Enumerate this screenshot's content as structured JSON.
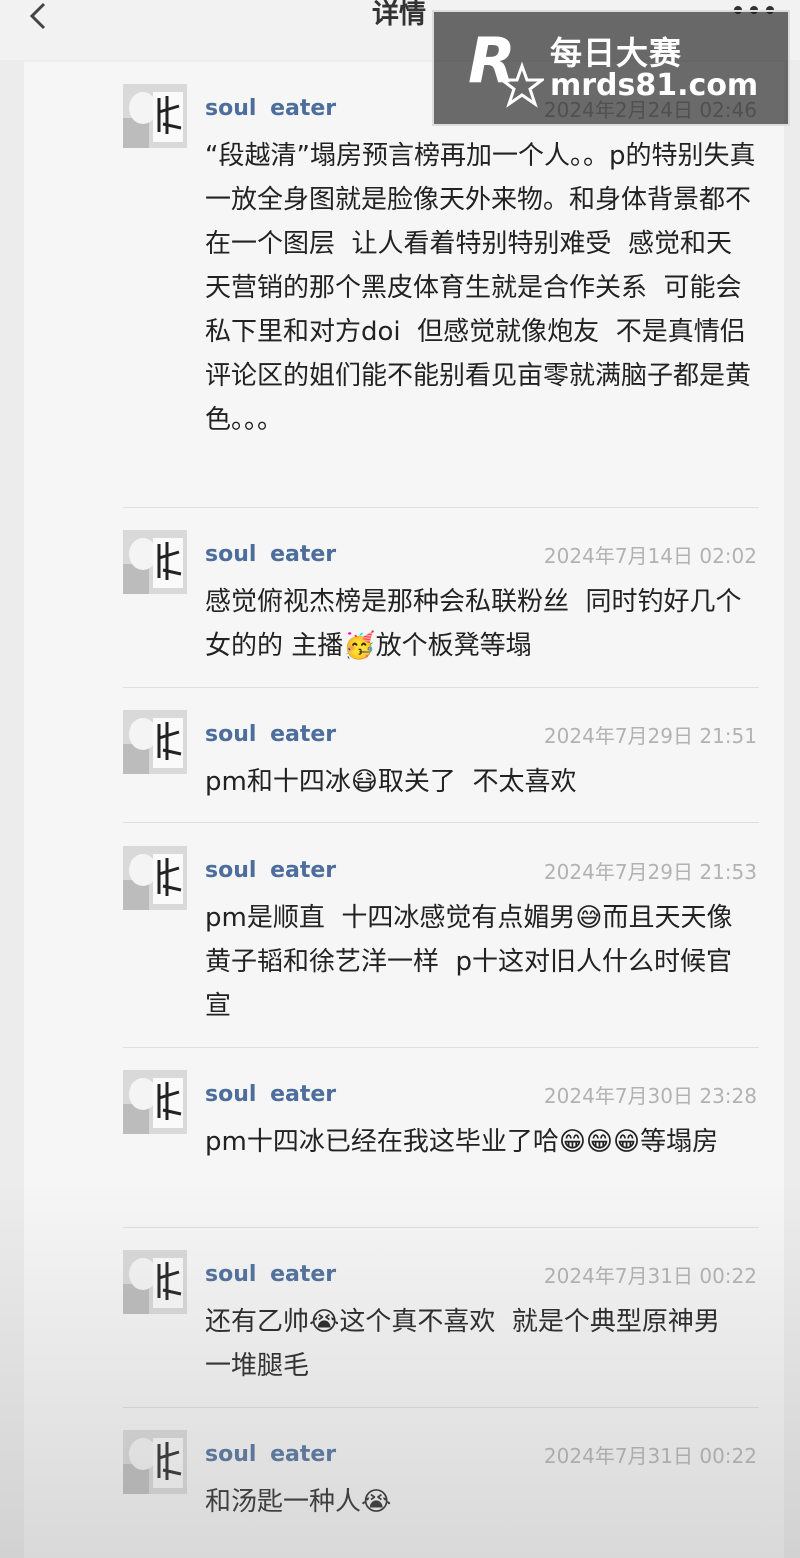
{
  "header": {
    "title": "详情"
  },
  "watermark": {
    "text_cn": "每日大赛",
    "url": "mrds81.com"
  },
  "comments": [
    {
      "user": "soul  eater",
      "time": "2024年2月24日  02:46",
      "text": "“段越清”塌房预言榜再加一个人。。p的特别失真  一放全身图就是脸像天外来物。和身体背景都不在一个图层  让人看着特别特别难受  感觉和天天营销的那个黑皮体育生就是合作关系  可能会私下里和对方doi  但感觉就像炮友  不是真情侣\n评论区的姐们能不能别看见亩零就满脑子都是黄色。。。"
    },
    {
      "user": "soul  eater",
      "time": "2024年7月14日  02:02",
      "text": "感觉俯视杰榜是那种会私联粉丝  同时钓好几个女的的 主播🥳放个板凳等塌"
    },
    {
      "user": "soul  eater",
      "time": "2024年7月29日  21:51",
      "text": "pm和十四冰😷取关了  不太喜欢"
    },
    {
      "user": "soul  eater",
      "time": "2024年7月29日  21:53",
      "text": "pm是顺直  十四冰感觉有点媚男😅而且天天像黄子韬和徐艺洋一样  p十这对旧人什么时候官宣"
    },
    {
      "user": "soul  eater",
      "time": "2024年7月30日  23:28",
      "text": "pm十四冰已经在我这毕业了哈😁😁😁等塌房"
    },
    {
      "user": "soul  eater",
      "time": "2024年7月31日  00:22",
      "text": "还有乙帅😭这个真不喜欢  就是个典型原神男  一堆腿毛"
    },
    {
      "user": "soul  eater",
      "time": "2024年7月31日  00:22",
      "text": "和汤匙一种人😭"
    }
  ]
}
